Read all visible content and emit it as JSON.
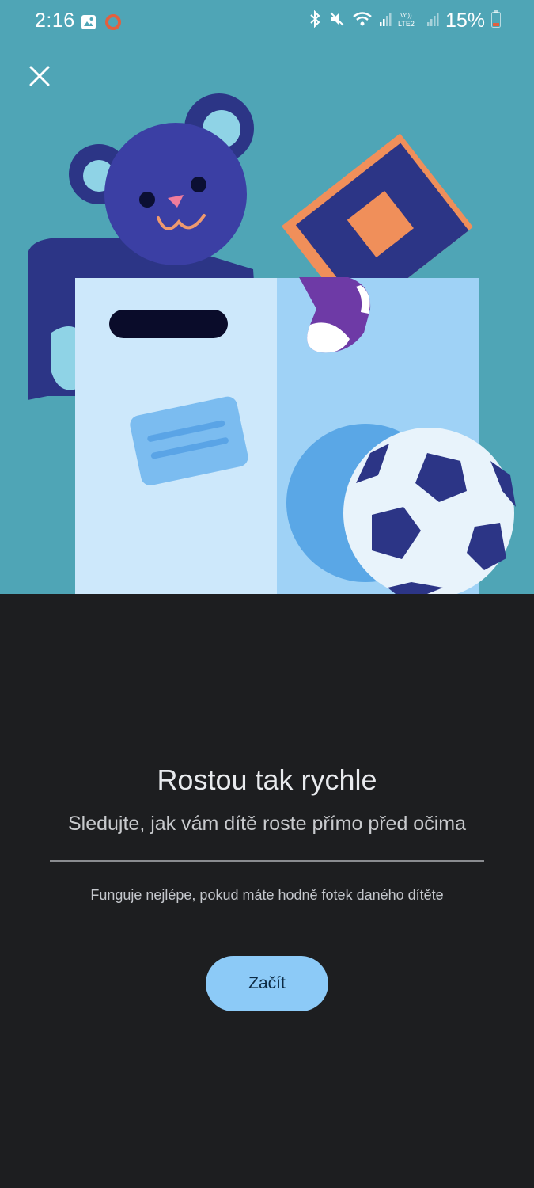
{
  "status_bar": {
    "time": "2:16",
    "battery_percent": "15%",
    "icons": [
      "gallery-icon",
      "recording-icon",
      "bluetooth-icon",
      "mute-icon",
      "wifi-icon",
      "signal-icon",
      "volte-lte2-icon",
      "signal-icon",
      "battery-icon"
    ],
    "battery_color": "#e2603f"
  },
  "header": {
    "close_icon": "close-icon"
  },
  "hero": {
    "background_color": "#4fa5b6",
    "illustration": [
      "teddy-bear",
      "book",
      "sock",
      "box",
      "soccer-ball"
    ]
  },
  "main": {
    "title": "Rostou tak rychle",
    "subtitle": "Sledujte, jak vám dítě roste přímo před očima",
    "note": "Funguje nejlépe, pokud máte hodně fotek daného dítěte",
    "start_label": "Začít"
  },
  "colors": {
    "accent": "#8ccaf7",
    "background": "#1d1e20"
  }
}
